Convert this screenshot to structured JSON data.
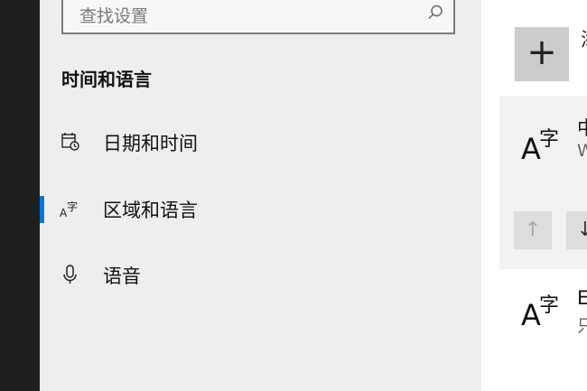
{
  "search": {
    "placeholder": "查找设置"
  },
  "sidebar": {
    "section_title": "时间和语言",
    "items": [
      {
        "label": "日期和时间",
        "icon": "calendar-clock-icon"
      },
      {
        "label": "区域和语言",
        "icon": "language-icon",
        "active": true
      },
      {
        "label": "语音",
        "icon": "microphone-icon"
      }
    ]
  },
  "content": {
    "add_label": "添",
    "add_glyph": "+",
    "languages": [
      {
        "icon_a": "A",
        "icon_zi": "字",
        "name": "中",
        "sub": "W"
      },
      {
        "icon_a": "A",
        "icon_zi": "字",
        "name": "E",
        "sub": "只"
      }
    ],
    "up_glyph": "↑",
    "down_glyph": "↓"
  },
  "colors": {
    "accent": "#0078d7",
    "sidebar_bg": "#eeeeee",
    "left_strip": "#1f1f1f"
  }
}
